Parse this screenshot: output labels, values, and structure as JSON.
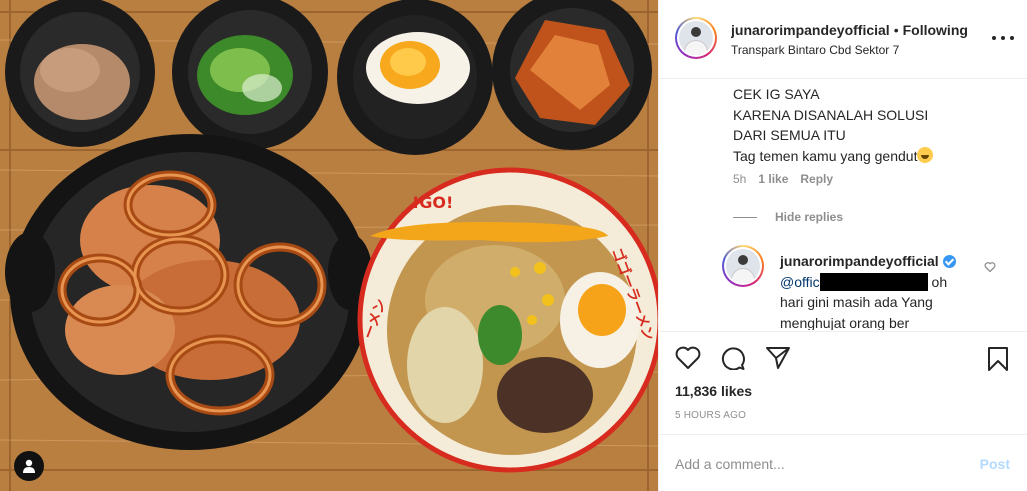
{
  "post": {
    "username": "junarorimpandeyofficial",
    "separator": "•",
    "follow_status": "Following",
    "location": "Transpark Bintaro Cbd Sektor 7"
  },
  "caption": {
    "lines": [
      "CEK IG SAYA",
      "KARENA DISANALAH SOLUSI",
      "DARI SEMUA ITU",
      "Tag temen kamu yang gendut"
    ],
    "time": "5h",
    "likes": "1 like",
    "reply_label": "Reply",
    "hide_replies": "Hide replies"
  },
  "reply": {
    "username": "junarorimpandeyofficial",
    "mention_prefix": "@offic",
    "text_after": "oh",
    "lines": [
      "hari gini masih ada Yang",
      "menghujat orang ber"
    ]
  },
  "actions": {
    "likes": "11,836 likes",
    "timestamp": "5 HOURS AGO"
  },
  "comment_box": {
    "placeholder": "Add a comment...",
    "post_label": "Post"
  },
  "image": {
    "bowl_text_top": "!GO!",
    "bowl_text_right": "ゴゴーラーメン",
    "bowl_text_left": "ーメン"
  },
  "colors": {
    "link": "#00376b",
    "verified": "#3897f0",
    "post_disabled": "#b3dbff",
    "muted": "#8e8e8e"
  },
  "icons": [
    "heart-icon",
    "comment-icon",
    "share-icon",
    "bookmark-icon",
    "more-icon",
    "user-tag-icon",
    "verified-badge-icon"
  ]
}
